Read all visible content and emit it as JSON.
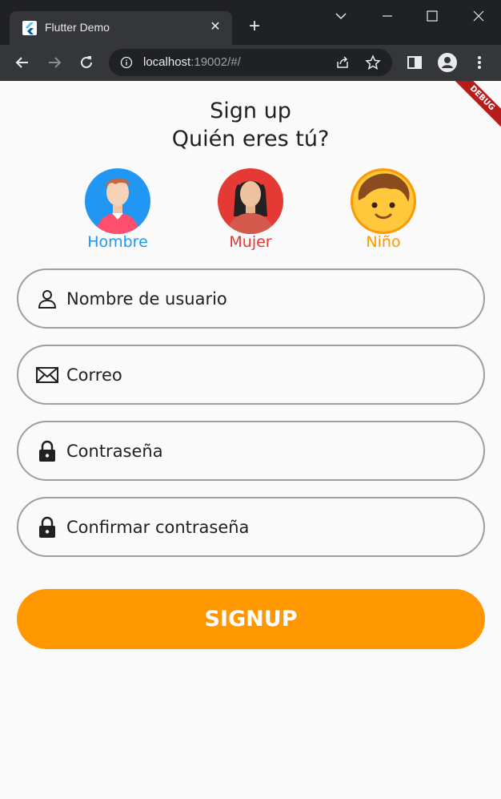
{
  "browser": {
    "tab_title": "Flutter Demo",
    "url_host": "localhost",
    "url_rest": ":19002/#/",
    "debug_label": "DEBUG"
  },
  "header": {
    "title_line1": "Sign up",
    "title_line2": "Quién eres tú?"
  },
  "avatars": [
    {
      "label": "Hombre",
      "color": "#2196f3"
    },
    {
      "label": "Mujer",
      "color": "#e53935"
    },
    {
      "label": "Niño",
      "color": "#ff9800"
    }
  ],
  "form": {
    "username_placeholder": "Nombre de usuario",
    "email_placeholder": "Correo",
    "password_placeholder": "Contraseña",
    "confirm_placeholder": "Confirmar contraseña",
    "submit_label": "SIGNUP"
  },
  "colors": {
    "accent": "#ff9800",
    "field_border": "#9e9e9e"
  }
}
